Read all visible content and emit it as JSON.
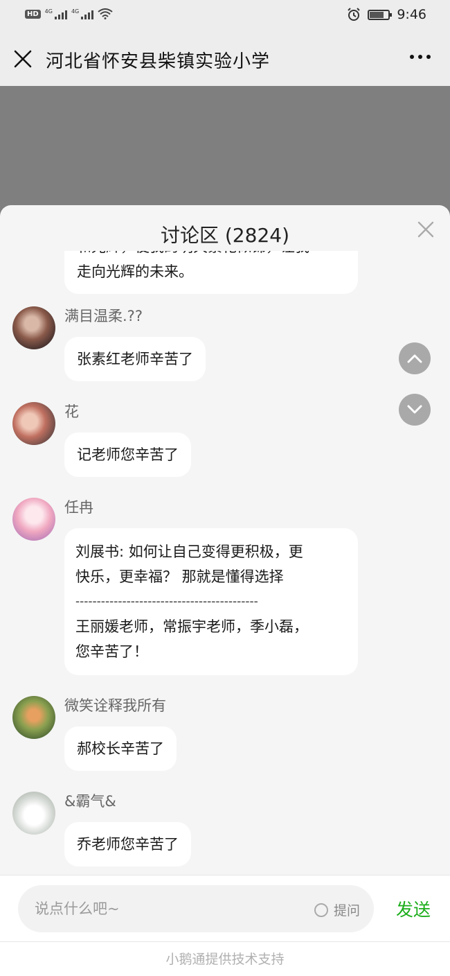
{
  "status_bar": {
    "badge": "HD",
    "signal1": "4G",
    "signal2": "4G",
    "time": "9:46"
  },
  "header": {
    "title": "河北省怀安县柴镇实验小学"
  },
  "discussion": {
    "title": "讨论区 (2824)",
    "messages": [
      {
        "user": "",
        "lines": [
          "和光辉，使我的明天繁花似锦，让我",
          "走向光辉的未来。"
        ]
      },
      {
        "user": "满目温柔.??",
        "lines": [
          "张素红老师辛苦了"
        ]
      },
      {
        "user": "花",
        "lines": [
          "记老师您辛苦了"
        ]
      },
      {
        "user": "任冉",
        "lines": [
          "刘展书: 如何让自己变得更积极，更",
          "快乐，更幸福？ 那就是懂得选择",
          "-------------------------------------------",
          "王丽媛老师，常振宇老师，季小磊，",
          "您辛苦了！"
        ]
      },
      {
        "user": "微笑诠释我所有",
        "lines": [
          "郝校长辛苦了"
        ]
      },
      {
        "user": "&霸气&",
        "lines": [
          "乔老师您辛苦了"
        ]
      }
    ]
  },
  "composer": {
    "placeholder": "说点什么吧~",
    "ask_label": "提问",
    "send_label": "发送"
  },
  "footer": {
    "text": "小鹅通提供技术支持"
  },
  "colors": {
    "accent": "#1aad19",
    "video_bg": "#7f7f7f",
    "panel_bg": "#f5f5f5"
  },
  "icons": [
    "close-icon",
    "more-icon",
    "scroll-up-icon",
    "scroll-down-icon",
    "panel-close-icon",
    "alarm-icon",
    "battery-icon",
    "wifi-icon"
  ]
}
